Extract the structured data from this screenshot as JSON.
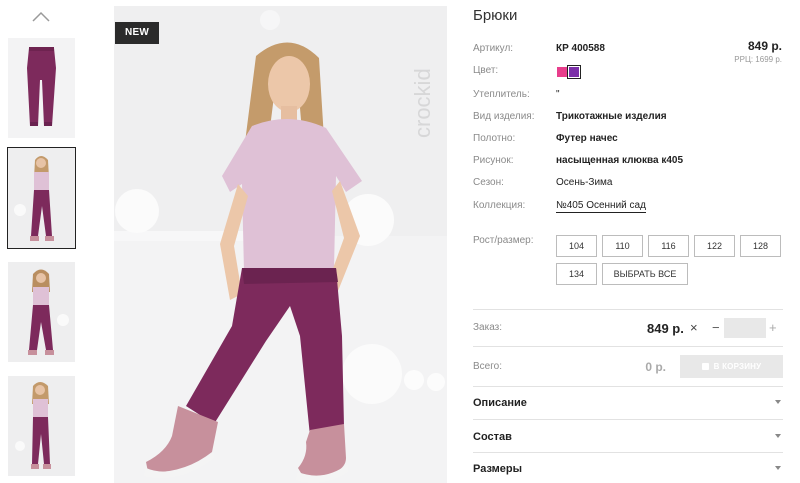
{
  "badge": "NEW",
  "brand": "crockid",
  "product": {
    "title": "Брюки",
    "price": "849 р.",
    "rrp": "РРЦ: 1699 р."
  },
  "attributes": [
    {
      "label": "Артикул:",
      "value": "КР 400588"
    },
    {
      "label": "Цвет:",
      "value": ""
    },
    {
      "label": "Утеплитель:",
      "value": "\""
    },
    {
      "label": "Вид изделия:",
      "value": "Трикотажные изделия"
    },
    {
      "label": "Полотно:",
      "value": "Футер начес"
    },
    {
      "label": "Рисунок:",
      "value": "насыщенная клюква к405"
    },
    {
      "label": "Сезон:",
      "value": "Осень-Зима"
    },
    {
      "label": "Коллекция:",
      "value": "№405 Осенний сад"
    }
  ],
  "colors": [
    {
      "name": "pink",
      "hex": "#e83e8c"
    },
    {
      "name": "purple",
      "hex": "#7b2fa8",
      "selected": true
    }
  ],
  "sizes": {
    "label": "Рост/размер:",
    "options": [
      "104",
      "110",
      "116",
      "122",
      "128",
      "134"
    ],
    "select_all": "ВЫБРАТЬ ВСЕ"
  },
  "order": {
    "label": "Заказ:",
    "price": "849 р.",
    "times": "×",
    "minus": "−",
    "plus": "+",
    "quantity": ""
  },
  "total": {
    "label": "Всего:",
    "value": "0 р.",
    "cart_button": "В КОРЗИНУ"
  },
  "accordion": [
    "Описание",
    "Состав",
    "Размеры"
  ],
  "icons": {
    "thumbs_up": "chevron-up-icon",
    "accordion": "chevron-down-icon",
    "cart": "bag-icon"
  },
  "palette": {
    "pants": "#7d2a5c",
    "shirt": "#dfc1d6",
    "background": "#efeff0"
  }
}
